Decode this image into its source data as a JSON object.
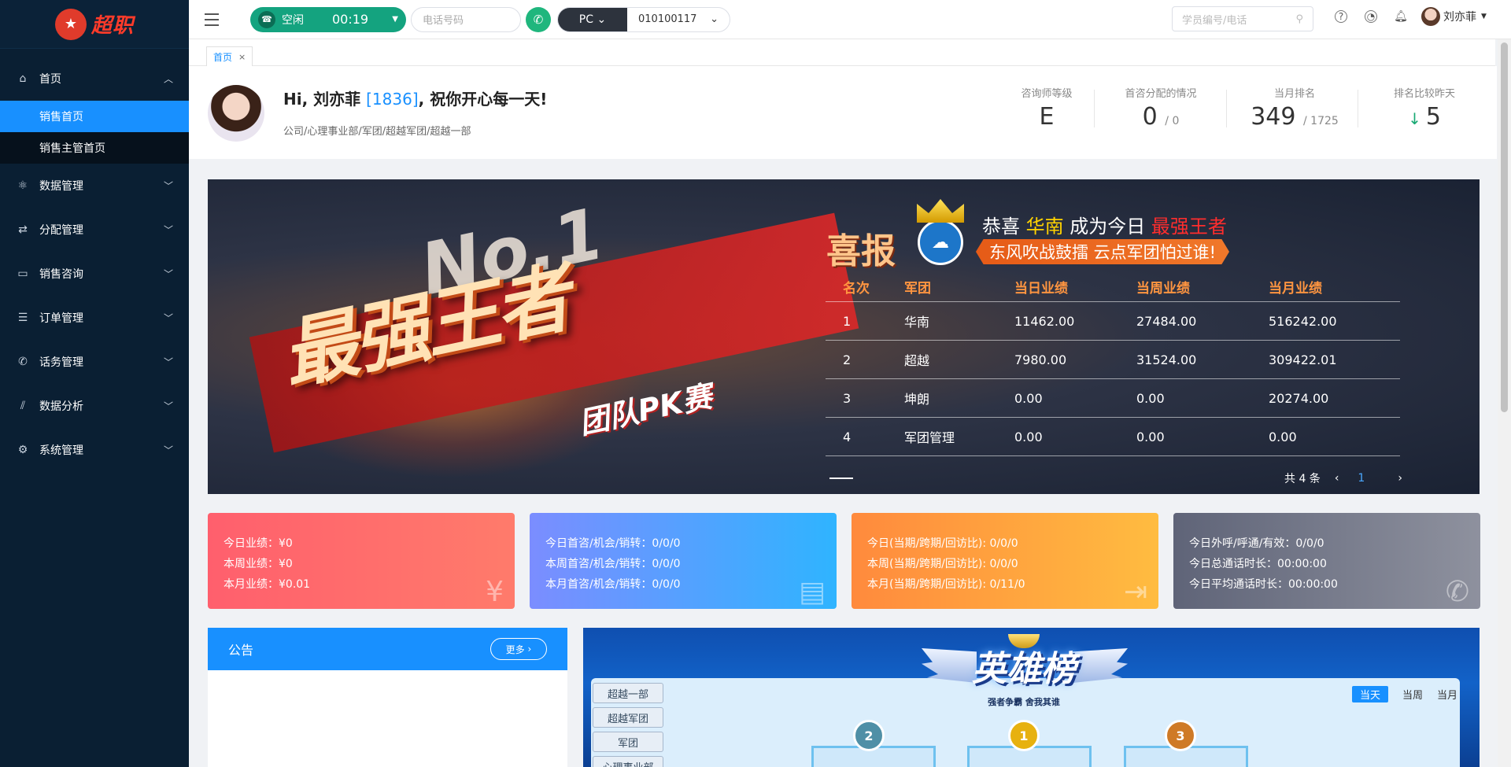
{
  "app": {
    "logo_text": "超职"
  },
  "sidebar": {
    "items": [
      {
        "label": "首页",
        "icon": "home-icon",
        "expanded": true,
        "children": [
          {
            "label": "销售首页",
            "active": true
          },
          {
            "label": "销售主管首页",
            "active": false
          }
        ]
      },
      {
        "label": "数据管理",
        "icon": "database-icon"
      },
      {
        "label": "分配管理",
        "icon": "distribute-icon"
      },
      {
        "label": "销售咨询",
        "icon": "chat-icon"
      },
      {
        "label": "订单管理",
        "icon": "order-icon"
      },
      {
        "label": "话务管理",
        "icon": "phone-icon"
      },
      {
        "label": "数据分析",
        "icon": "chart-icon"
      },
      {
        "label": "系统管理",
        "icon": "settings-icon"
      }
    ]
  },
  "header": {
    "status_label": "空闲",
    "timer": "00:19",
    "phone_placeholder": "电话号码",
    "device": "PC",
    "extension": "010100117",
    "search_placeholder": "学员编号/电话",
    "user_name": "刘亦菲"
  },
  "tabs": [
    {
      "label": "首页",
      "close": "×"
    }
  ],
  "welcome": {
    "greeting_prefix": "Hi, 刘亦菲 ",
    "user_id": "[1836]",
    "greeting_suffix": ", 祝你开心每一天!",
    "org_path": "公司/心理事业部/军团/超越军团/超越一部",
    "stats": [
      {
        "label": "咨询师等级",
        "value": "E",
        "sub": ""
      },
      {
        "label": "首咨分配的情况",
        "value": "0",
        "sub": "/ 0"
      },
      {
        "label": "当月排名",
        "value": "349",
        "sub": "/ 1725"
      },
      {
        "label": "排名比较昨天",
        "value": "5",
        "sub": "",
        "trend": "down"
      }
    ]
  },
  "banner": {
    "no1": "No.1",
    "main_title": "最强王者",
    "sub_title": "团队PK赛",
    "xibao": "喜报",
    "congrats_prefix": "恭喜 ",
    "winner": "华南",
    "congrats_mid": " 成为今日 ",
    "king": "最强王者",
    "slogan": "东风吹战鼓擂 云点军团怕过谁!",
    "table": {
      "headers": [
        "名次",
        "军团",
        "当日业绩",
        "当周业绩",
        "当月业绩"
      ],
      "rows": [
        [
          "1",
          "华南",
          "11462.00",
          "27484.00",
          "516242.00"
        ],
        [
          "2",
          "超越",
          "7980.00",
          "31524.00",
          "309422.01"
        ],
        [
          "3",
          "坤朗",
          "0.00",
          "0.00",
          "20274.00"
        ],
        [
          "4",
          "军团管理",
          "0.00",
          "0.00",
          "0.00"
        ]
      ]
    },
    "pager": {
      "total": "共 4 条",
      "prev": "‹",
      "current": "1",
      "next": "›"
    }
  },
  "cards": [
    {
      "lines": [
        "今日业绩：¥0",
        "本周业绩：¥0",
        "本月业绩：¥0.01"
      ],
      "icon": "yuan-icon",
      "color": "#ff6b6b"
    },
    {
      "lines": [
        "今日首咨/机会/销转：0/0/0",
        "本周首咨/机会/销转：0/0/0",
        "本月首咨/机会/销转：0/0/0"
      ],
      "icon": "message-icon",
      "color": "#4a9cff"
    },
    {
      "lines": [
        "今日(当期/跨期/回访比): 0/0/0",
        "本周(当期/跨期/回访比): 0/0/0",
        "本月(当期/跨期/回访比): 0/11/0"
      ],
      "icon": "login-icon",
      "color": "#ffa040"
    },
    {
      "lines": [
        "今日外呼/呼通/有效：0/0/0",
        "今日总通话时长：00:00:00",
        "今日平均通话时长：00:00:00"
      ],
      "icon": "phone-icon",
      "color": "#6b6f80"
    }
  ],
  "notice": {
    "title": "公告",
    "more": "更多"
  },
  "hero_board": {
    "title": "英雄榜",
    "subtitle": "强者争霸 舍我其谁",
    "teams": [
      "超越一部",
      "超越军团",
      "军团",
      "心理事业部"
    ],
    "periods": [
      "当天",
      "当周",
      "当月"
    ],
    "active_period": "当天",
    "medals": [
      "2",
      "1",
      "3"
    ]
  }
}
